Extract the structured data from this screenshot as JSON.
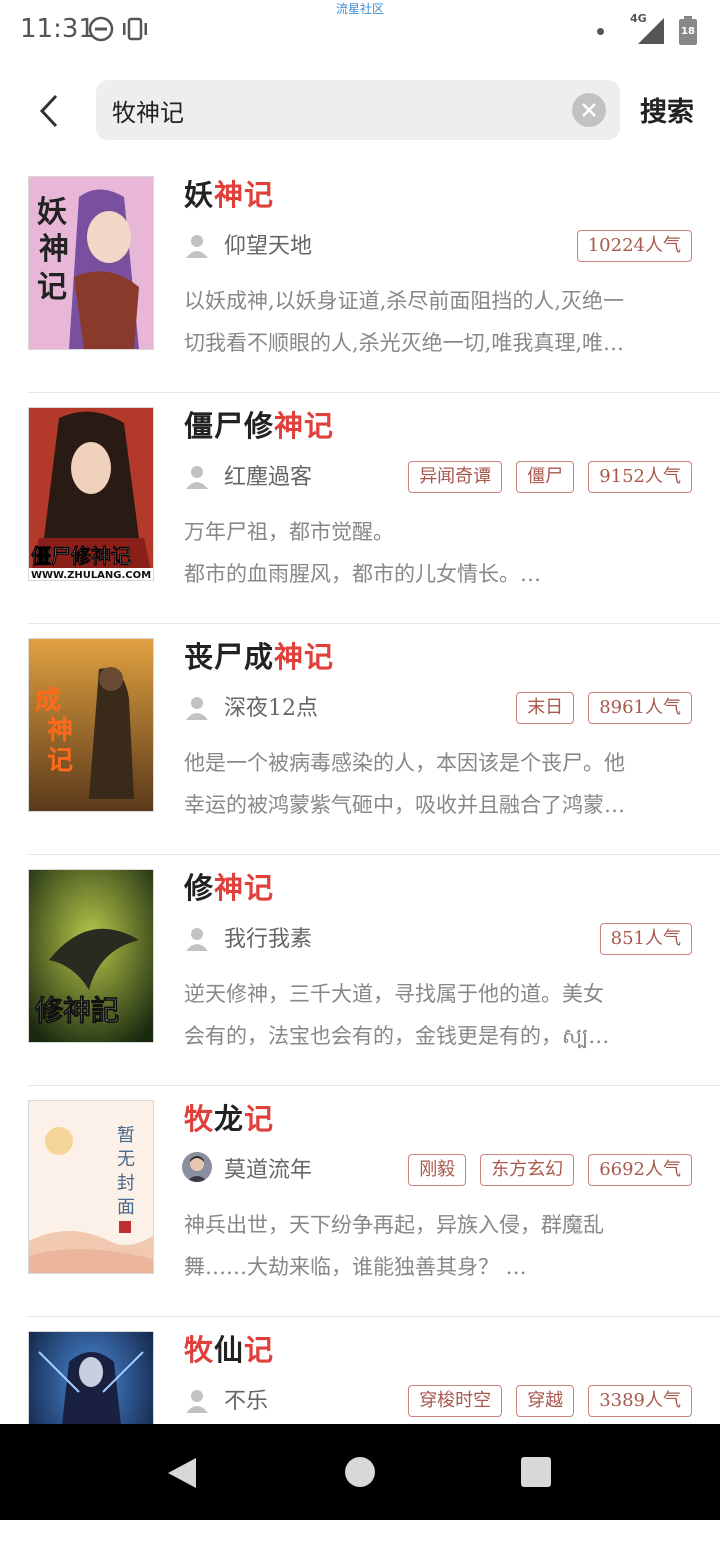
{
  "status": {
    "time": "11:31",
    "watermark": "流星社区",
    "network": "4G",
    "battery": "18"
  },
  "search": {
    "query": "牧神记",
    "button_label": "搜索"
  },
  "results": [
    {
      "title_parts": [
        "妖",
        "神记"
      ],
      "author": "仰望天地",
      "tags": [
        "10224人气"
      ],
      "desc_lines": [
        "以妖成神,以妖身证道,杀尽前面阻挡的人,灭绝一",
        "切我看不顺眼的人,杀光灭绝一切,唯我真理,唯…"
      ],
      "cover_text": "妖神记"
    },
    {
      "title_parts": [
        "僵尸修",
        "神记"
      ],
      "author": "红塵過客",
      "tags": [
        "异闻奇谭",
        "僵尸",
        "9152人气"
      ],
      "desc_lines": [
        "万年尸祖，都市觉醒。",
        "都市的血雨腥风，都市的儿女情长。…"
      ],
      "cover_text": "僵尸修神记",
      "cover_sub": "WWW.ZHULANG.COM"
    },
    {
      "title_parts": [
        "丧尸成",
        "神记"
      ],
      "author": "深夜12点",
      "tags": [
        "末日",
        "8961人气"
      ],
      "desc_lines": [
        "他是一个被病毒感染的人，本因该是个丧尸。他",
        "幸运的被鸿蒙紫气砸中，吸收并且融合了鸿蒙…"
      ],
      "cover_text": "丧尸成神记"
    },
    {
      "title_parts": [
        "修",
        "神记"
      ],
      "author": "我行我素",
      "tags": [
        "851人气"
      ],
      "desc_lines": [
        "逆天修神，三千大道，寻找属于他的道。美女",
        "会有的，法宝也会有的，金钱更是有的，ស្ប…"
      ],
      "cover_text": "修神記"
    },
    {
      "title_parts": [
        "牧",
        "龙",
        "记"
      ],
      "author": "莫道流年",
      "tags": [
        "刚毅",
        "东方玄幻",
        "6692人气"
      ],
      "desc_lines": [
        "神兵出世，天下纷争再起，异族入侵，群魔乱",
        "舞……大劫来临，谁能独善其身？ …"
      ],
      "cover_text": "暂无封面"
    },
    {
      "title_parts": [
        "牧",
        "仙",
        "记"
      ],
      "author": "不乐",
      "tags": [
        "穿梭时空",
        "穿越",
        "3389人气"
      ],
      "desc_lines": [
        "",
        ""
      ],
      "cover_text": ""
    }
  ],
  "colors": {
    "highlight": "#e0403b",
    "tag_border": "#c9847b",
    "tag_text": "#a8584d"
  }
}
